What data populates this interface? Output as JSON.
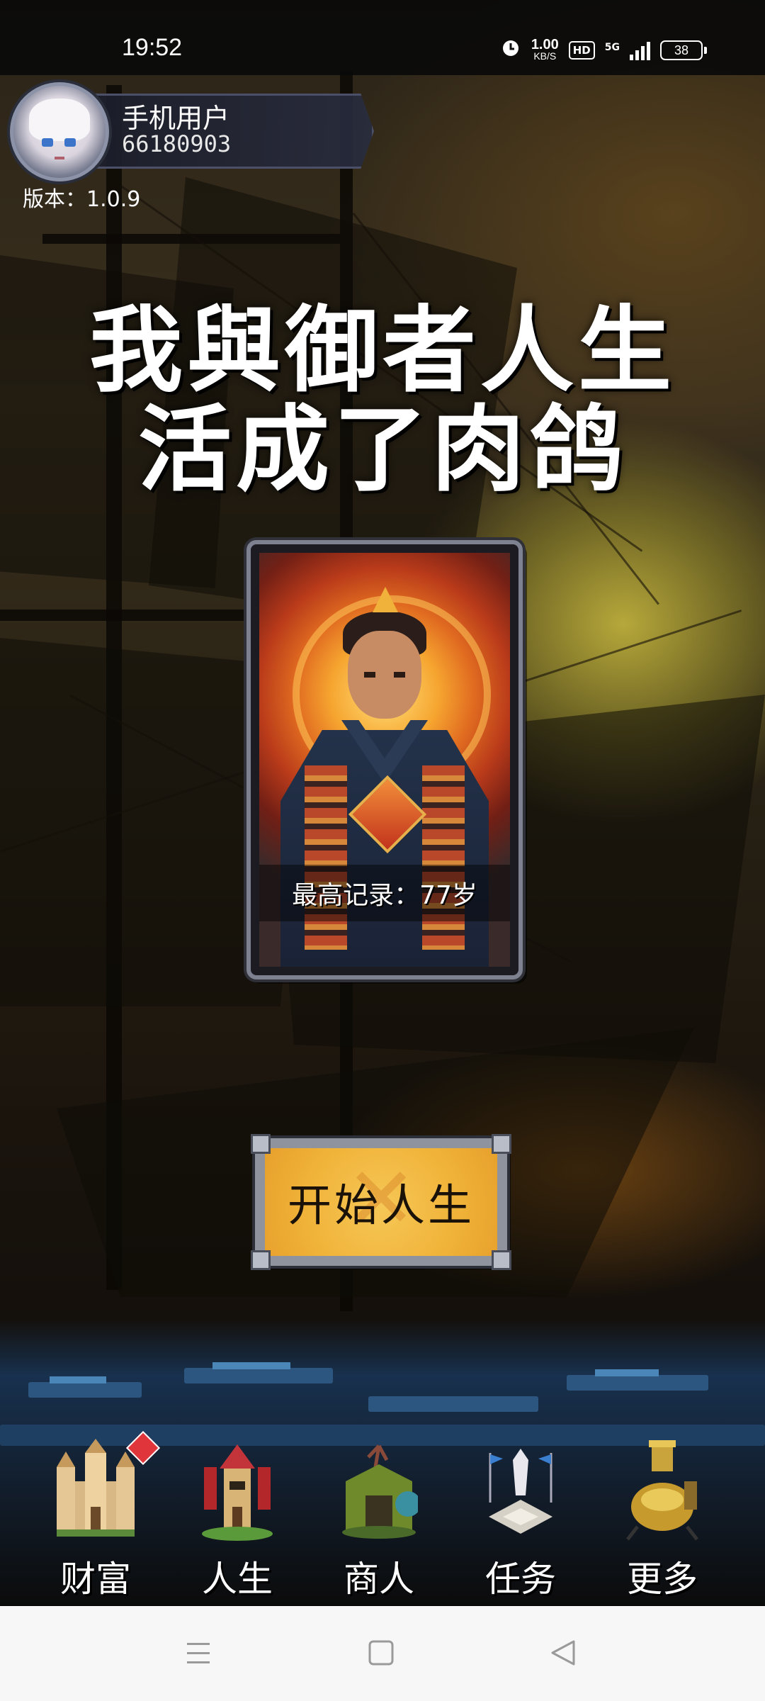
{
  "status_bar": {
    "time": "19:52",
    "net_speed_value": "1.00",
    "net_speed_unit": "KB/S",
    "hd_label": "HD",
    "network_label": "5G",
    "battery_level": "38"
  },
  "profile": {
    "user_name": "手机用户",
    "user_id": "66180903",
    "version": "版本：1.0.9"
  },
  "title": {
    "line1": "我與御者人生",
    "line2": "活成了肉鸽"
  },
  "card": {
    "record_label": "最高记录：77岁"
  },
  "start_button": {
    "label": "开始人生"
  },
  "bottom_nav": {
    "items": [
      {
        "label": "财富",
        "icon": "castle-icon",
        "badge": true
      },
      {
        "label": "人生",
        "icon": "tower-icon",
        "badge": false
      },
      {
        "label": "商人",
        "icon": "merchant-hut-icon",
        "badge": false
      },
      {
        "label": "任务",
        "icon": "monument-icon",
        "badge": false
      },
      {
        "label": "更多",
        "icon": "golden-machine-icon",
        "badge": false
      }
    ]
  },
  "system_nav": {
    "menu_icon": "menu-icon",
    "home_icon": "home-icon",
    "back_icon": "back-icon"
  }
}
